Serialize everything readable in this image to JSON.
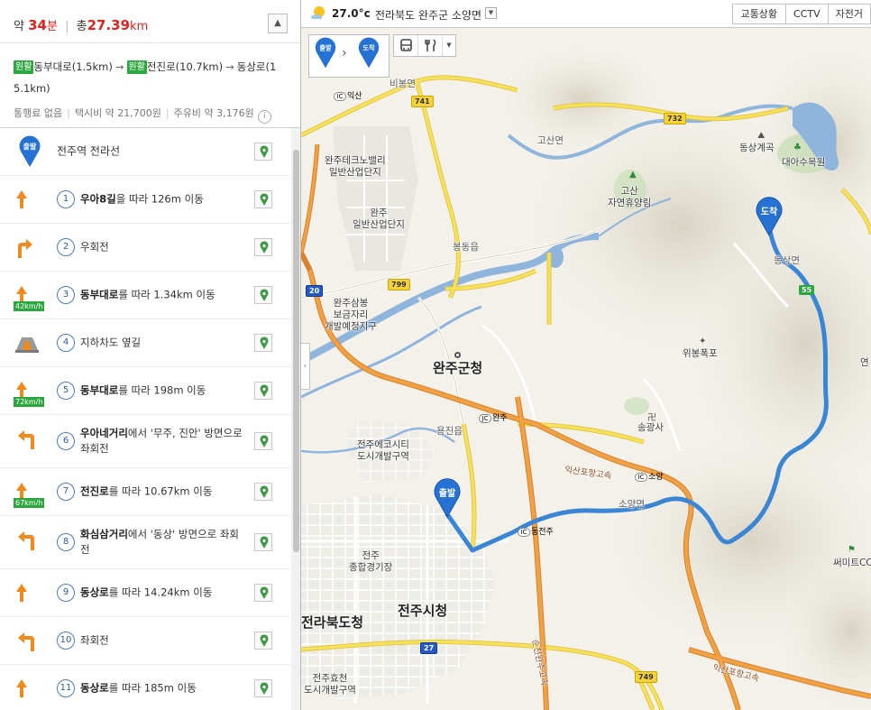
{
  "summary": {
    "time_prefix": "약",
    "time_value": "34",
    "time_unit": "분",
    "dist_prefix": "총",
    "dist_value": "27.39",
    "dist_unit": "km",
    "collapse_icon": "chevron-up-icon",
    "route_badge_1": "원활",
    "route_seg_1": "동부대로(1.5km)",
    "route_badge_2": "원활",
    "route_seg_2": "전진로(10.7km)",
    "route_seg_3a": "동상로(1",
    "route_seg_3b": "5.1km)",
    "arrow": "→",
    "toll": "통행료 없음",
    "taxi": "택시비 약 21,700원",
    "fuel": "주유비 약 3,176원",
    "info_icon": "i"
  },
  "steps": [
    {
      "type": "start",
      "badge": "출발",
      "text": "전주역 전라선"
    },
    {
      "num": "1",
      "bold": "우아8길",
      "text": "을 따라 126m 이동",
      "icon": "straight-arrow-icon"
    },
    {
      "num": "2",
      "bold": "",
      "text": "우회전",
      "icon": "right-turn-icon"
    },
    {
      "num": "3",
      "bold": "동부대로",
      "text": "를 따라 1.34km 이동",
      "icon": "straight-arrow-icon",
      "speed": "42km/h"
    },
    {
      "num": "4",
      "bold": "",
      "text": "지하차도 옆길",
      "icon": "underpass-icon"
    },
    {
      "num": "5",
      "bold": "동부대로",
      "text": "를 따라 198m 이동",
      "icon": "straight-arrow-icon",
      "speed": "72km/h"
    },
    {
      "num": "6",
      "bold": "우아네거리",
      "text": "에서 '무주, 진안' 방면으로 좌회전",
      "icon": "left-turn-icon"
    },
    {
      "num": "7",
      "bold": "전진로",
      "text": "를 따라 10.67km 이동",
      "icon": "straight-arrow-icon",
      "speed": "67km/h"
    },
    {
      "num": "8",
      "bold": "화심삼거리",
      "text": "에서 '동상' 방면으로 좌회전",
      "icon": "left-turn-icon"
    },
    {
      "num": "9",
      "bold": "동상로",
      "text": "를 따라 14.24km 이동",
      "icon": "straight-arrow-icon"
    },
    {
      "num": "10",
      "bold": "",
      "text": "좌회전",
      "icon": "left-turn-icon"
    },
    {
      "num": "11",
      "bold": "동상로",
      "text": "를 따라 185m 이동",
      "icon": "straight-arrow-icon"
    }
  ],
  "topbar": {
    "temp": "27.0°c",
    "location": "전라북도 완주군 소양면",
    "tabs": [
      "교통상황",
      "CCTV",
      "자전거"
    ]
  },
  "markers": {
    "start": "출발",
    "end": "도착"
  },
  "labels": {
    "bibong": "비봉면",
    "iksan": "익산",
    "gosan": "고산면",
    "donsang_gyegok": "동상계곡",
    "daea_arboretum": "대아수목원",
    "techno": "완주테크노밸리",
    "techno2": "일반산업단지",
    "gosan_forest1": "고산",
    "gosan_forest2": "자연휴양림",
    "wanju_ind1": "완주",
    "wanju_ind2": "일반산업단지",
    "bongdong": "봉동읍",
    "dongsang_myeon": "동상면",
    "wanju_samsung1": "완주삼봉",
    "wanju_samsung2": "보금자리",
    "wanju_samsung3": "개발예정지구",
    "wanju_office": "완주군청",
    "wibong_falls": "위봉폭포",
    "yongjin": "용진읍",
    "wanju_ic": "완주",
    "songgwangsa": "송광사",
    "eco1": "전주에코시티",
    "eco2": "도시개발구역",
    "iksan_pohang": "익산포항고속",
    "soyang": "소양",
    "soyang_myeon": "소양면",
    "dongjeonju": "동전주",
    "stadium1": "전주",
    "stadium2": "종합경기장",
    "jeonbuk_office": "전라북도청",
    "jeonju_office": "전주시청",
    "hyoja1": "전주효천",
    "hyoja2": "도시개발구역",
    "summit": "써미트CC",
    "iksan_pohang2": "익산포항고속",
    "sunchang_hwy": "순천완주고속",
    "yeon": "연",
    "r741": "741",
    "r732": "732",
    "r799": "799",
    "r20": "20",
    "r27": "27",
    "r749": "749",
    "r55": "55",
    "ic": "IC",
    "jc": "JC"
  },
  "colors": {
    "route": "#3a86d4",
    "highway": "#f0a143",
    "national_road": "#f7e05a",
    "water": "#8fb5dd",
    "accent_red": "#e8201c",
    "badge_green": "#2aa83d"
  }
}
